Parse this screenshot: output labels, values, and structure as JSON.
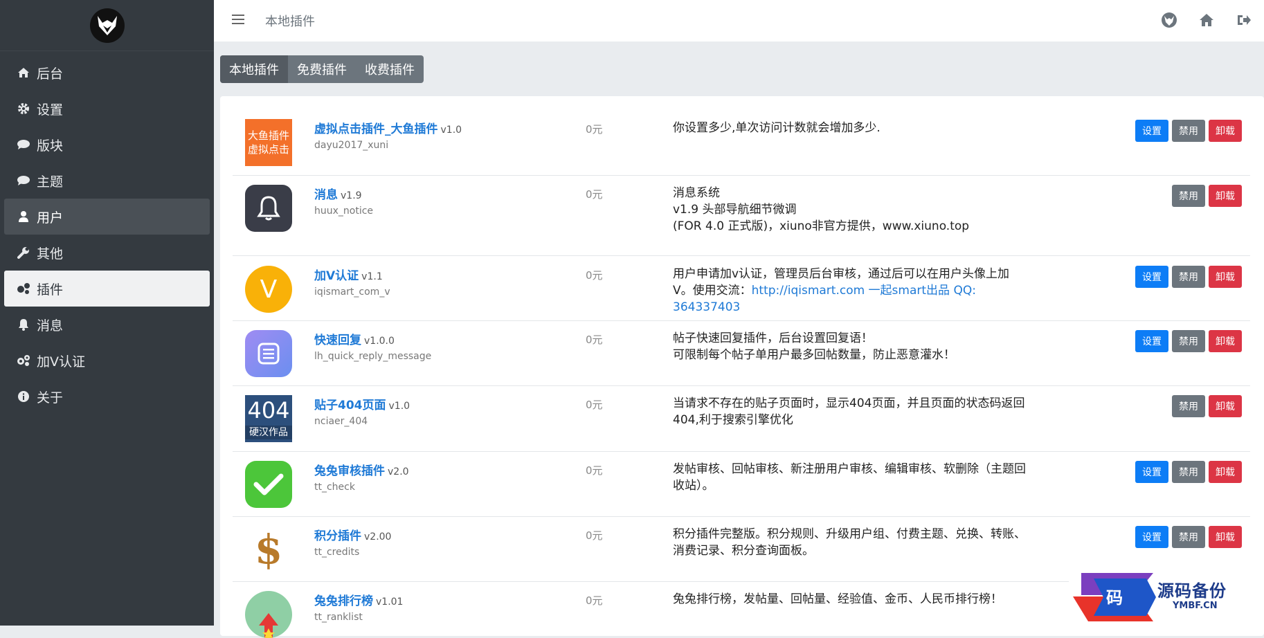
{
  "topbar": {
    "title": "本地插件"
  },
  "sidebar": {
    "items": [
      {
        "label": "后台",
        "icon": "home-icon"
      },
      {
        "label": "设置",
        "icon": "gear-icon"
      },
      {
        "label": "版块",
        "icon": "comment-icon"
      },
      {
        "label": "主题",
        "icon": "comment-icon"
      },
      {
        "label": "用户",
        "icon": "user-icon"
      },
      {
        "label": "其他",
        "icon": "wrench-icon"
      },
      {
        "label": "插件",
        "icon": "gears-icon"
      },
      {
        "label": "消息",
        "icon": "bell-icon"
      },
      {
        "label": "加V认证",
        "icon": "gears-icon"
      },
      {
        "label": "关于",
        "icon": "info-icon"
      }
    ]
  },
  "tabs": [
    "本地插件",
    "免费插件",
    "收费插件"
  ],
  "buttons": {
    "settings": "设置",
    "disable": "禁用",
    "uninstall": "卸载"
  },
  "plugins": [
    {
      "name": "虚拟点击插件_大鱼插件",
      "version": "v1.0",
      "dir": "dayu2017_xuni",
      "price": "0元",
      "desc": [
        "你设置多少,单次访问计数就会增加多少."
      ],
      "thumb_lines": [
        "大鱼插件",
        "虚拟点击"
      ],
      "has_settings": true
    },
    {
      "name": "消息",
      "version": "v1.9",
      "dir": "huux_notice",
      "price": "0元",
      "desc": [
        "消息系统",
        "v1.9 头部导航细节微调",
        "(FOR 4.0 正式版)，xiuno非官方提供，www.xiuno.top"
      ],
      "has_settings": false
    },
    {
      "name": "加V认证",
      "version": "v1.1",
      "dir": "iqismart_com_v",
      "price": "0元",
      "desc_l1": "用户申请加v认证，管理员后台审核，通过后可以在用户头像上加",
      "desc_l2_pre": "V。使用交流：",
      "desc_link": "http://iqismart.com 一起smart出品 QQ: 364337403",
      "thumb_text": "V",
      "has_settings": true
    },
    {
      "name": "快速回复",
      "version": "v1.0.0",
      "dir": "lh_quick_reply_message",
      "price": "0元",
      "desc": [
        "帖子快速回复插件，后台设置回复语！",
        "可限制每个帖子单用户最多回帖数量，防止恶意灌水！"
      ],
      "has_settings": true
    },
    {
      "name": "贴子404页面",
      "version": "v1.0",
      "dir": "nciaer_404",
      "price": "0元",
      "desc": [
        "当请求不存在的贴子页面时，显示404页面，并且页面的状态码返回",
        "404,利于搜索引擎优化"
      ],
      "thumb_lines": [
        "404",
        "硬汉作品"
      ],
      "has_settings": false
    },
    {
      "name": "兔兔审核插件",
      "version": "v2.0",
      "dir": "tt_check",
      "price": "0元",
      "desc": [
        "发帖审核、回帖审核、新注册用户审核、编辑审核、软删除（主题回",
        "收站）。"
      ],
      "has_settings": true
    },
    {
      "name": "积分插件",
      "version": "v2.00",
      "dir": "tt_credits",
      "price": "0元",
      "desc": [
        "积分插件完整版。积分规则、升级用户组、付费主题、兑换、转账、",
        "消费记录、积分查询面板。"
      ],
      "thumb_text": "$",
      "has_settings": true
    },
    {
      "name": "兔兔排行榜",
      "version": "v1.01",
      "dir": "tt_ranklist",
      "price": "0元",
      "desc": [
        "兔兔排行榜，发帖量、回帖量、经验值、金币、人民币排行榜！"
      ],
      "has_settings": false
    }
  ],
  "watermark": {
    "title": "源码备份",
    "subtitle": "YMBF.CN",
    "mark": "码"
  },
  "colors": {
    "sidebar": "#343a40",
    "primary": "#0d7df6",
    "secondary": "#6c757d",
    "danger": "#dc3545",
    "link": "#1f7ad6"
  }
}
